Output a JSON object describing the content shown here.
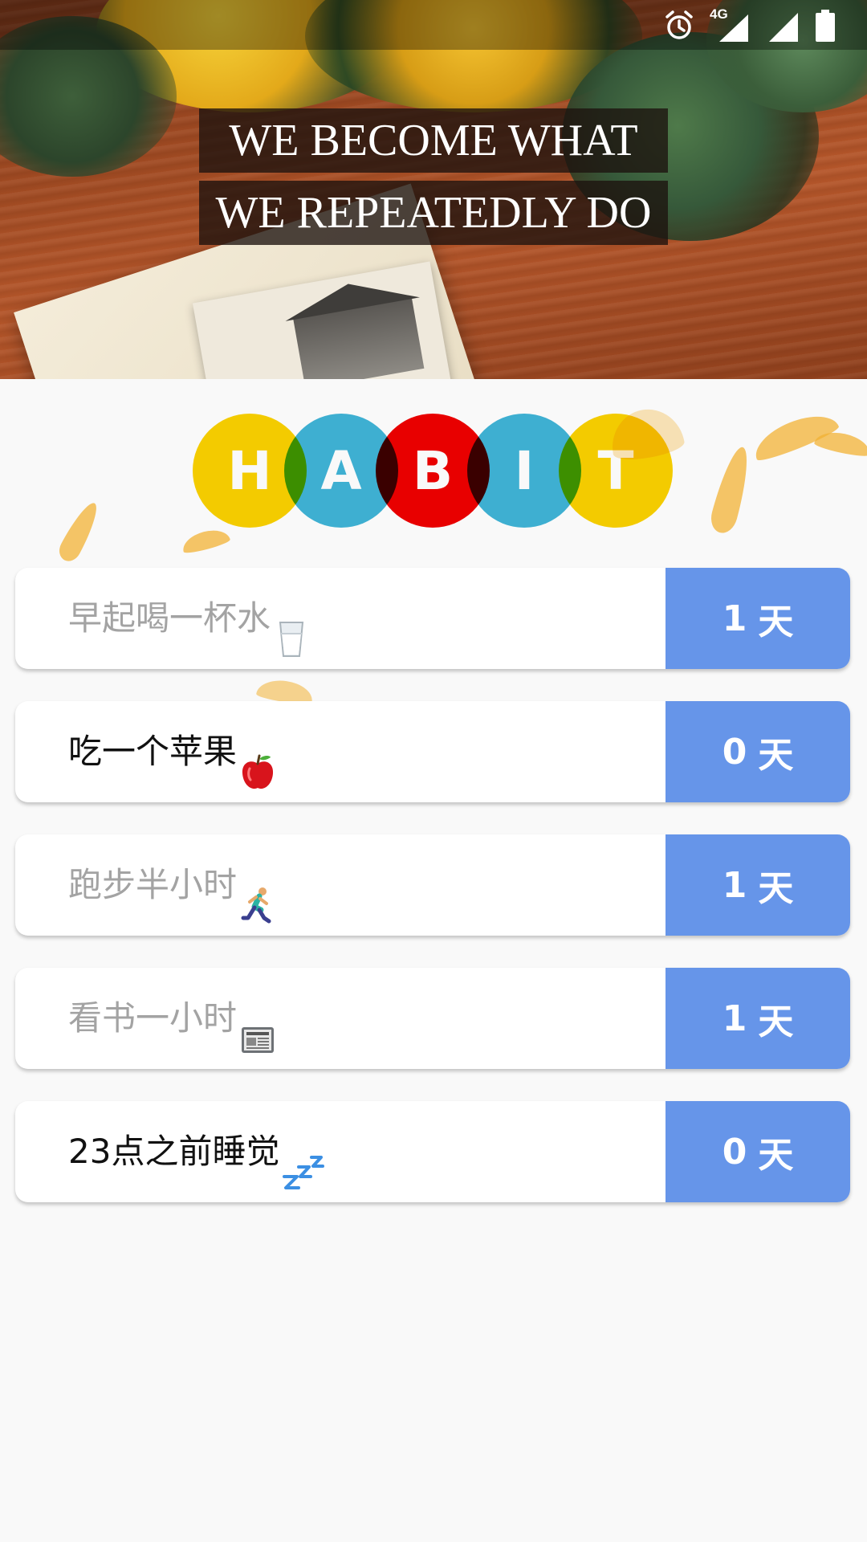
{
  "status_bar": {
    "network": "4G",
    "icons": [
      "alarm-icon",
      "signal-icon",
      "signal-icon",
      "battery-icon"
    ]
  },
  "banner": {
    "line1": "WE BECOME WHAT",
    "line2": "WE REPEATEDLY DO"
  },
  "logo": {
    "letters": [
      "H",
      "A",
      "B",
      "I",
      "T"
    ],
    "colors": [
      "#f9d000",
      "#3fb3d6",
      "#ee0000",
      "#3fb3d6",
      "#f9d000"
    ]
  },
  "habits": [
    {
      "name": "早起喝一杯水",
      "emoji": "glass-of-milk-icon",
      "count": "1",
      "unit": "天",
      "done": true
    },
    {
      "name": "吃一个苹果",
      "emoji": "red-apple-icon",
      "count": "0",
      "unit": "天",
      "done": false
    },
    {
      "name": "跑步半小时",
      "emoji": "runner-icon",
      "count": "1",
      "unit": "天",
      "done": true
    },
    {
      "name": "看书一小时",
      "emoji": "newspaper-icon",
      "count": "1",
      "unit": "天",
      "done": true
    },
    {
      "name": "23点之前睡觉",
      "emoji": "zzz-icon",
      "count": "0",
      "unit": "天",
      "done": false
    }
  ],
  "colors": {
    "button": "#6695e9",
    "done_text": "#a3a3a3",
    "todo_text": "#111111",
    "background": "#f9f9f9"
  }
}
